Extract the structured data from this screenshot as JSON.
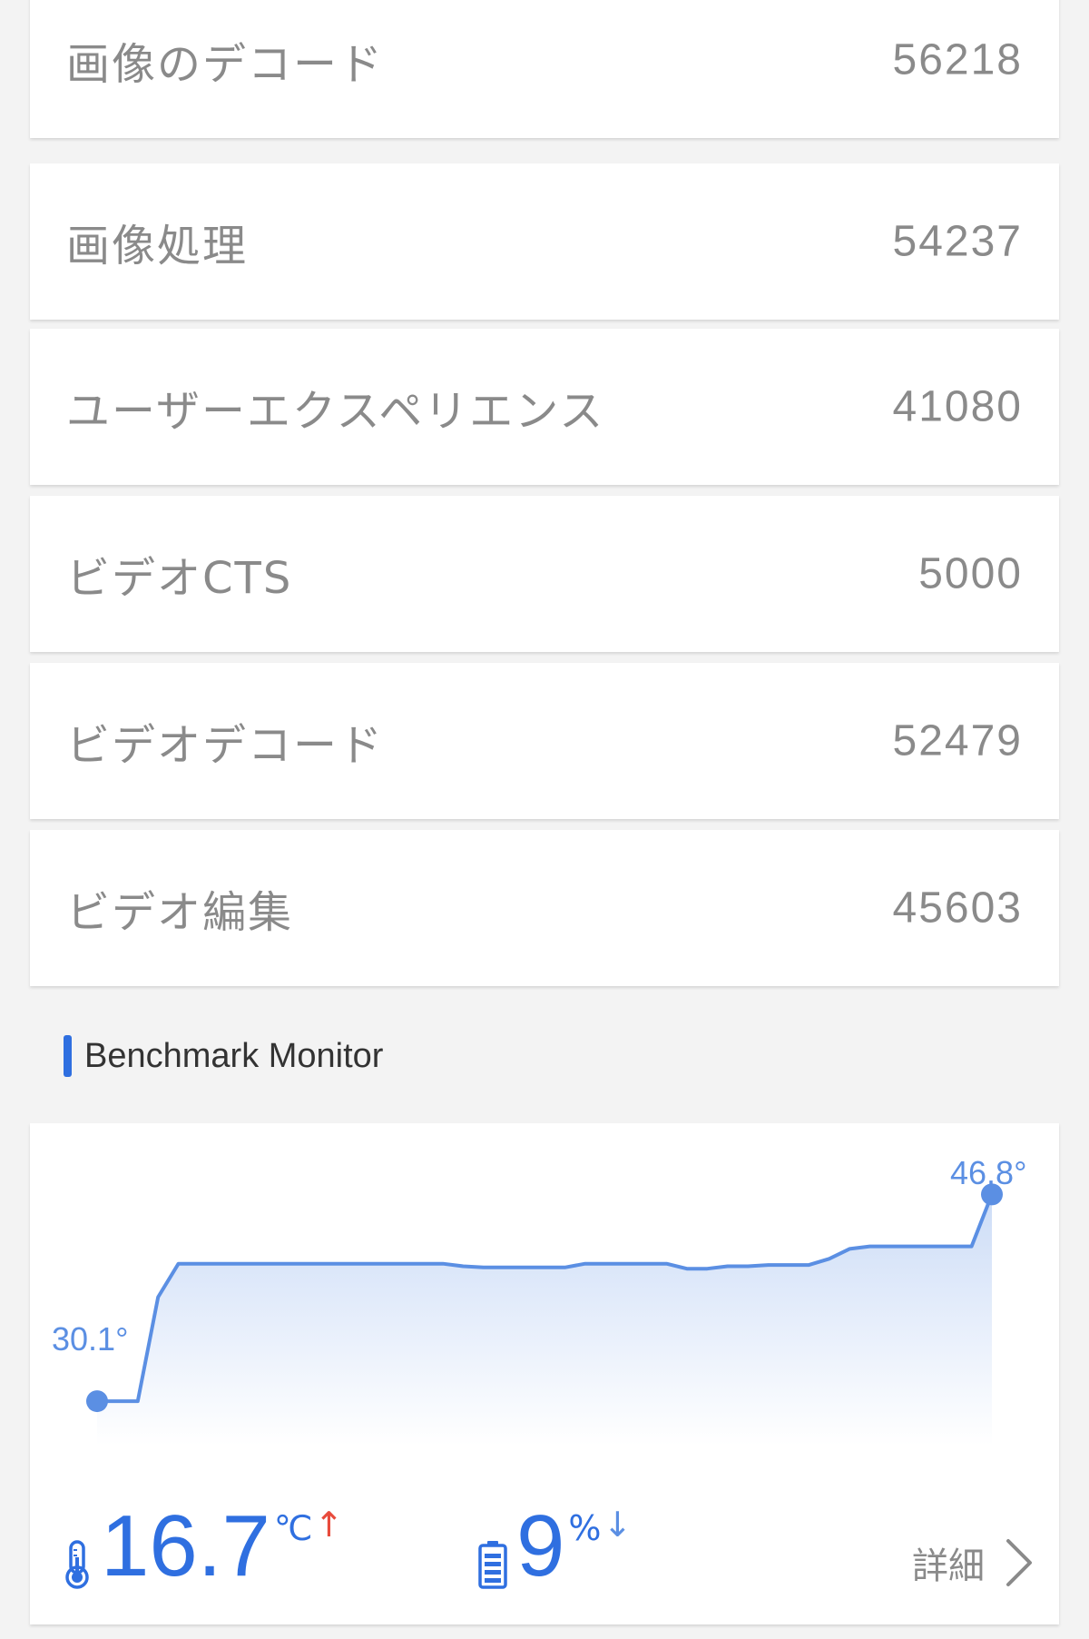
{
  "scores": [
    {
      "label": "画像のデコード",
      "value": "56218"
    },
    {
      "label": "画像処理",
      "value": "54237"
    },
    {
      "label": "ユーザーエクスペリエンス",
      "value": "41080"
    },
    {
      "label": "ビデオCTS",
      "value": "5000"
    },
    {
      "label": "ビデオデコード",
      "value": "52479"
    },
    {
      "label": "ビデオ編集",
      "value": "45603"
    }
  ],
  "monitor": {
    "section_title": "Benchmark Monitor",
    "start_label": "30.1°",
    "end_label": "46.8°",
    "temp_value": "16.7",
    "temp_unit": "℃",
    "temp_arrow": "↑",
    "battery_value": "9",
    "battery_unit": "%",
    "battery_arrow": "↓",
    "detail_label": "詳細",
    "thermometer_icon": "thermometer-icon",
    "battery_icon": "battery-icon",
    "chevron_icon": "chevron-right-icon",
    "accent_color": "#2f6fe0",
    "line_color": "#5b8fe3",
    "up_arrow_color": "#e84b3c"
  },
  "chart_data": {
    "type": "area",
    "title": "",
    "xlabel": "",
    "ylabel": "",
    "series": [
      {
        "values": [
          30.1,
          30.1,
          30.1,
          38.5,
          41.2,
          41.2,
          41.2,
          41.2,
          41.2,
          41.2,
          41.2,
          41.2,
          41.2,
          41.2,
          41.2,
          41.2,
          41.2,
          41.2,
          41.0,
          40.9,
          40.9,
          40.9,
          40.9,
          40.9,
          41.2,
          41.2,
          41.2,
          41.2,
          41.2,
          40.8,
          40.8,
          41.0,
          41.0,
          41.1,
          41.1,
          41.1,
          41.6,
          42.4,
          42.6,
          42.6,
          42.6,
          42.6,
          42.6,
          42.6,
          46.8
        ]
      }
    ],
    "ylim": [
      26,
      48
    ],
    "start_label": "30.1°",
    "end_label": "46.8°",
    "grid": false
  }
}
